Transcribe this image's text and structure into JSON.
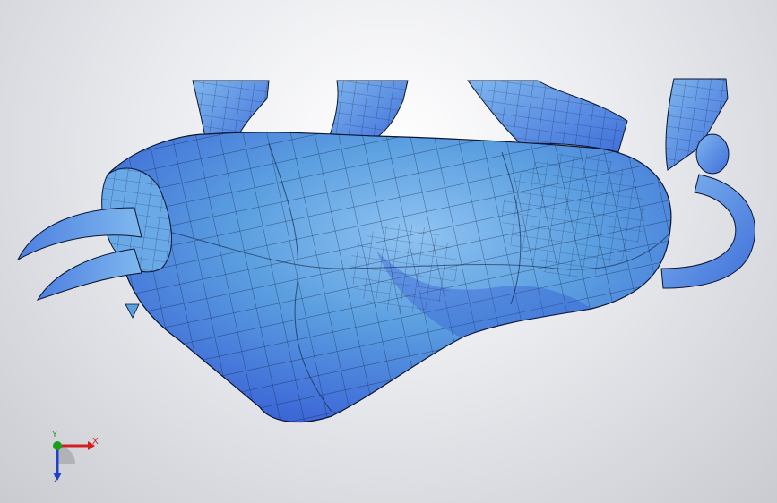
{
  "view": {
    "background_top": "#ffffff",
    "background_bottom": "#c9cbd1",
    "model_color": "#5b9fe0",
    "model_shadow_color": "#2f5fd8",
    "mesh_line_color": "#0a1530"
  },
  "triad": {
    "x_label": "X",
    "y_label": "Y",
    "z_label": "Z",
    "x_color": "#d21f1f",
    "y_color": "#19a019",
    "z_color": "#1f3fd0"
  }
}
